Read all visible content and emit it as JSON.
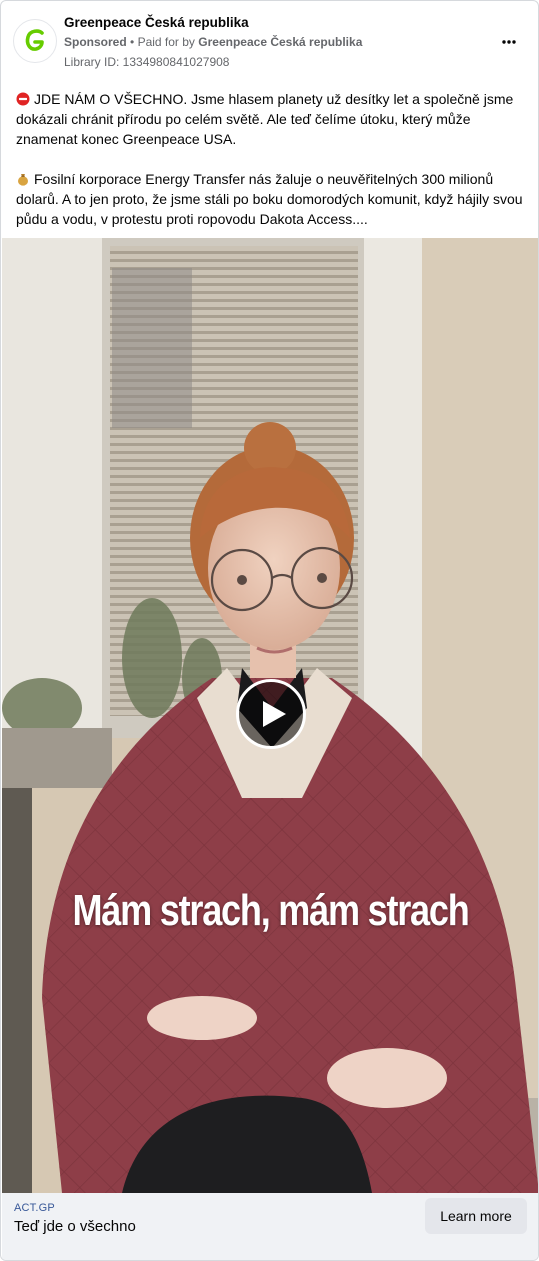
{
  "header": {
    "page_name": "Greenpeace Česká republika",
    "sponsored_label": "Sponsored",
    "paid_for_prefix": "Paid for by",
    "paid_for_name": "Greenpeace Česká republika",
    "library_id": "Library ID: 1334980841027908",
    "avatar_icon": "greenpeace-g-logo",
    "more_icon": "more-horizontal-icon",
    "brand_color": "#66cc00"
  },
  "post": {
    "paragraph1_emoji": "no-entry-emoji",
    "paragraph1": "JDE NÁM O VŠECHNO. Jsme hlasem planety už desítky let a společně jsme dokázali chránit přírodu po celém světě. Ale teď čelíme útoku, který může znamenat konec Greenpeace USA.",
    "paragraph2_emoji": "money-bag-emoji",
    "paragraph2": "Fosilní korporace Energy Transfer nás žaluje o neuvěřitelných 300 milionů dolarů. A to jen proto, že jsme stáli po boku domorodých komunit, když hájily svou půdu a vodu, v protestu proti ropovodu Dakota Access...."
  },
  "media": {
    "caption": "Mám strach, mám strach",
    "play_icon": "play-icon"
  },
  "footer": {
    "link_domain": "ACT.GP",
    "link_title": "Teď jde o všechno",
    "cta_label": "Learn more"
  }
}
